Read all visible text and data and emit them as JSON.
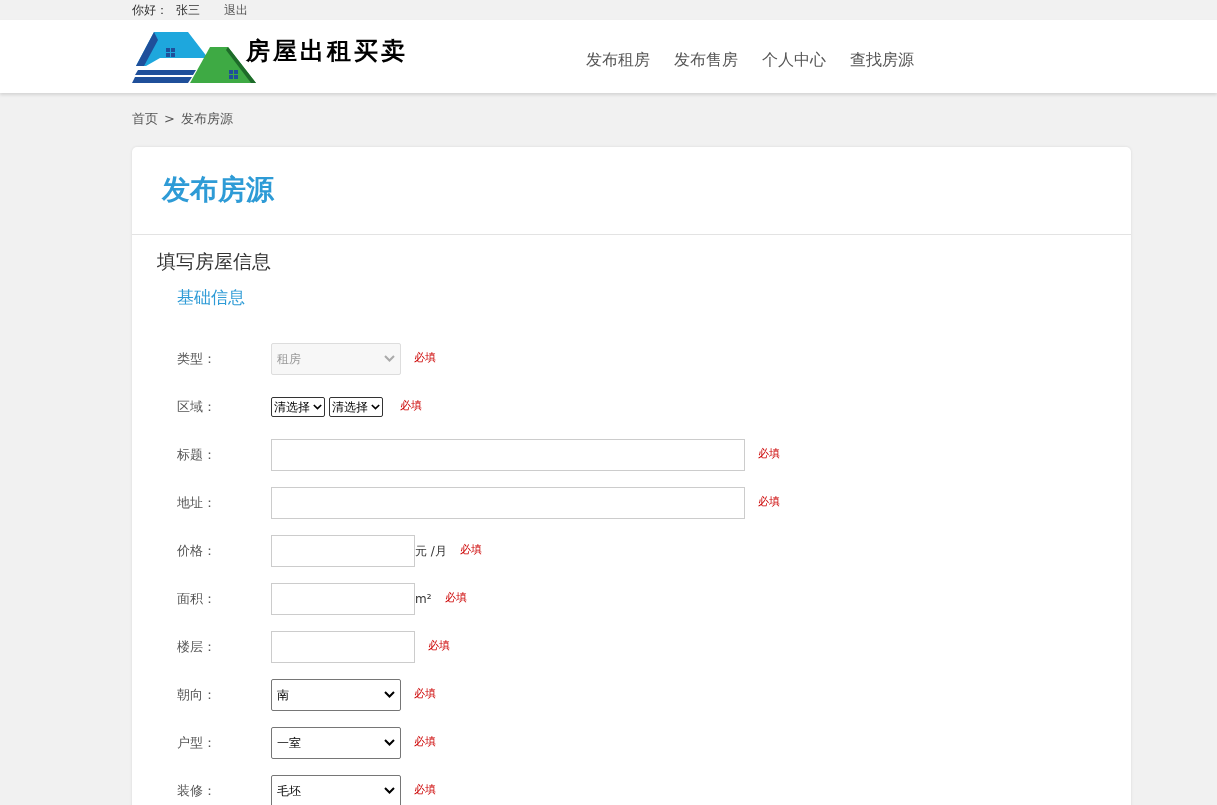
{
  "top_bar": {
    "greeting": "你好：",
    "user_name": "张三",
    "logout": "退出"
  },
  "header": {
    "logo_text": "房屋出租买卖",
    "nav": [
      {
        "label": "发布租房"
      },
      {
        "label": "发布售房"
      },
      {
        "label": "个人中心"
      },
      {
        "label": "查找房源"
      }
    ]
  },
  "breadcrumb": {
    "items": [
      "首页",
      "发布房源"
    ],
    "separator": ">"
  },
  "card": {
    "title": "发布房源",
    "section_title": "填写房屋信息",
    "subsection_title": "基础信息",
    "fields": [
      {
        "label": "类型：",
        "kind": "select",
        "value": "租房",
        "disabled": true,
        "required": "必填"
      },
      {
        "label": "区域：",
        "kind": "select-pair",
        "values": [
          "清选择",
          "清选择"
        ],
        "required": "必填"
      },
      {
        "label": "标题：",
        "kind": "text-wide",
        "required": "必填"
      },
      {
        "label": "地址：",
        "kind": "text-wide",
        "required": "必填"
      },
      {
        "label": "价格：",
        "kind": "text-short",
        "unit": "元 /月",
        "required": "必填"
      },
      {
        "label": "面积：",
        "kind": "text-short",
        "unit": "m²",
        "required": "必填"
      },
      {
        "label": "楼层：",
        "kind": "text-short",
        "required": "必填"
      },
      {
        "label": "朝向：",
        "kind": "select",
        "value": "南",
        "disabled": false,
        "required": "必填"
      },
      {
        "label": "户型：",
        "kind": "select",
        "value": "一室",
        "disabled": false,
        "required": "必填"
      },
      {
        "label": "装修：",
        "kind": "select",
        "value": "毛坯",
        "disabled": false,
        "required": "必填"
      }
    ]
  }
}
